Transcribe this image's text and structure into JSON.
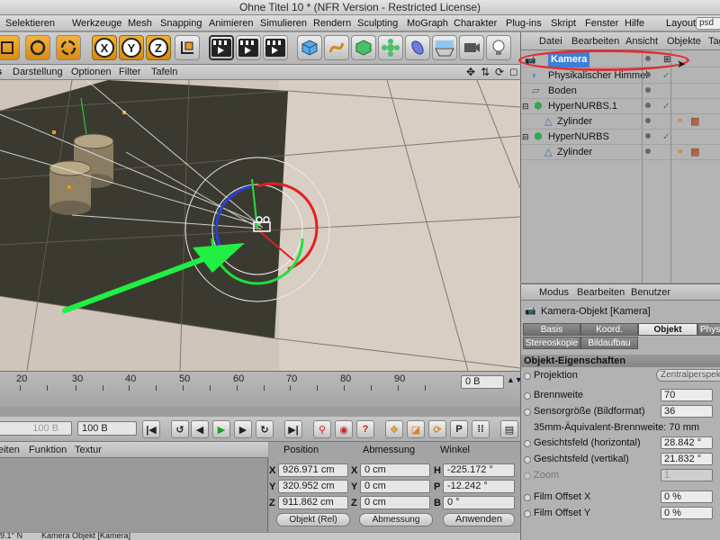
{
  "window": {
    "title": "Ohne Titel 10 * (NFR Version - Restricted License)"
  },
  "menubar": {
    "items": [
      "Selektieren",
      "Werkzeuge",
      "Mesh",
      "Snapping",
      "Animieren",
      "Simulieren",
      "Rendern",
      "Sculpting",
      "MoGraph",
      "Charakter",
      "Plug-ins",
      "Skript",
      "Fenster",
      "Hilfe"
    ],
    "layout_label": "Layout:",
    "layout_value": "psd"
  },
  "toolbar": {
    "x_label": "X",
    "y_label": "Y",
    "z_label": "Z"
  },
  "viewport_menu": {
    "items": [
      "Darstellung",
      "Optionen",
      "Filter",
      "Tafeln"
    ]
  },
  "timeline": {
    "ticks": [
      "20",
      "30",
      "40",
      "50",
      "60",
      "70",
      "80",
      "90"
    ],
    "frame_value": "0 B"
  },
  "transport": {
    "field_a": "100 B",
    "field_b": "100 B"
  },
  "material_menu": {
    "items": [
      "eiten",
      "Funktion",
      "Textur"
    ]
  },
  "coordinates": {
    "headers": [
      "Position",
      "Abmessung",
      "Winkel"
    ],
    "rows": [
      {
        "axis": "X",
        "pos": "926.971 cm",
        "size_axis": "X",
        "size": "0 cm",
        "rot_axis": "H",
        "rot": "-225.172 °"
      },
      {
        "axis": "Y",
        "pos": "320.952 cm",
        "size_axis": "Y",
        "size": "0 cm",
        "rot_axis": "P",
        "rot": "-12.242 °"
      },
      {
        "axis": "Z",
        "pos": "911.862 cm",
        "size_axis": "Z",
        "size": "0 cm",
        "rot_axis": "B",
        "rot": "0 °"
      }
    ],
    "mode_dropdown": "Objekt (Rel)",
    "size_dropdown": "Abmessung",
    "apply_button": "Anwenden"
  },
  "statusbar": {
    "left": "9.1° N",
    "text": "Kamera Objekt [Kamera]"
  },
  "object_manager": {
    "menu": [
      "Datei",
      "Bearbeiten",
      "Ansicht",
      "Objekte",
      "Tag"
    ],
    "objects": [
      {
        "name": "Kamera",
        "selected": true
      },
      {
        "name": "Physikalischer Himmel"
      },
      {
        "name": "Boden"
      },
      {
        "name": "HyperNURBS.1"
      },
      {
        "name": "Zylinder"
      },
      {
        "name": "HyperNURBS"
      },
      {
        "name": "Zylinder"
      }
    ]
  },
  "attribute_manager": {
    "menu": [
      "Modus",
      "Bearbeiten",
      "Benutzer"
    ],
    "object_title": "Kamera-Objekt [Kamera]",
    "tabs_row1": [
      "Basis",
      "Koord.",
      "Objekt",
      "Physik"
    ],
    "tabs_row2": [
      "Stereoskopie",
      "Bildaufbau"
    ],
    "section": "Objekt-Eigenschaften",
    "projection_label": "Projektion",
    "projection_value": "Zentralperspektive",
    "focal_label": "Brennweite",
    "focal_value": "70",
    "sensor_label": "Sensorgröße (Bildformat)",
    "sensor_value": "36",
    "equiv_text": "35mm-Äquivalent-Brennweite: 70 mm",
    "fov_h_label": "Gesichtsfeld (horizontal)",
    "fov_h_value": "28.842 °",
    "fov_v_label": "Gesichtsfeld (vertikal)",
    "fov_v_value": "21.832 °",
    "zoom_label": "Zoom",
    "zoom_value": "1",
    "offx_label": "Film Offset X",
    "offx_value": "0 %",
    "offy_label": "Film Offset Y",
    "offy_value": "0 %"
  },
  "colors": {
    "annotation_arrow": "#22ee44",
    "highlight_ellipse": "#e03030",
    "floor": "#3a3a30",
    "background": "#cfc5ba"
  }
}
